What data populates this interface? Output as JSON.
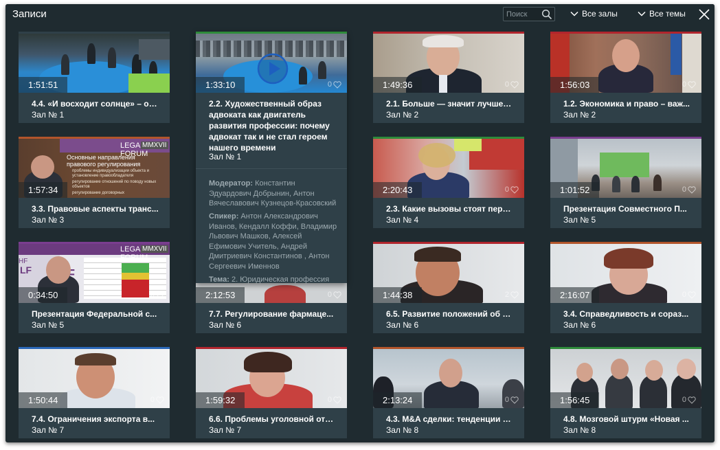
{
  "header": {
    "title": "Записи",
    "search_placeholder": "Поиск",
    "filter_halls": "Все залы",
    "filter_topics": "Все темы"
  },
  "colors": {
    "background": "#1f2b30",
    "card": "#2f4048",
    "accent_green": "#2e8b3a",
    "accent_red": "#b1252d",
    "accent_purple": "#7a3d8f",
    "accent_blue": "#2a68b8",
    "accent_brown": "#b2552b"
  },
  "cards": [
    {
      "title": "4.4. «И восходит солнце» – оц...",
      "hall": "Зал № 1",
      "duration": "1:51:51",
      "likes": "",
      "accent": "none"
    },
    {
      "title": "2.2. Художественный образ адвоката как двигатель развития профессии: почему адвокат так и не стал героем нашего времени",
      "hall": "Зал № 1",
      "duration": "1:33:10",
      "likes": "0",
      "accent": "green",
      "moderator_label": "Модератор:",
      "moderator": "Константин Эдуардович Добрынин, Антон Вячеславович Кузнецов-Красовский",
      "speaker_label": "Спикер:",
      "speakers": "Антон Александрович Иванов, Кендалл Коффи, Владимир Львович Машков, Алексей Ефимович Учитель, Андрей Дмитриевич Константинов , Антон Сергеевич Именнов",
      "topic_label": "Тема:",
      "topic": "2. Юридическая профессия"
    },
    {
      "title": "2.1. Больше — значит лучше?...",
      "hall": "Зал № 2",
      "duration": "1:49:36",
      "likes": "0",
      "accent": "red"
    },
    {
      "title": "1.2. Экономика и право – важ...",
      "hall": "Зал № 2",
      "duration": "1:56:03",
      "likes": "0",
      "accent": "red"
    },
    {
      "title": "3.3. Правовые аспекты транс...",
      "hall": "Зал № 3",
      "duration": "1:57:34",
      "likes": "",
      "accent": "brown"
    },
    {
      "title": "2.3. Какие вызовы стоят пере...",
      "hall": "Зал № 4",
      "duration": "2:20:43",
      "likes": "0",
      "accent": "green"
    },
    {
      "title": "Презентация Совместного П...",
      "hall": "Зал № 5",
      "duration": "1:01:52",
      "likes": "0",
      "accent": "purple"
    },
    {
      "title": "Презентация Федеральной с...",
      "hall": "Зал № 5",
      "duration": "0:34:50",
      "likes": "0",
      "accent": "purple"
    },
    {
      "title": "7.7. Регулирование фармаце...",
      "hall": "Зал № 6",
      "duration": "2:12:53",
      "likes": "0",
      "accent": "none"
    },
    {
      "title": "6.5. Развитие положений об о...",
      "hall": "Зал № 6",
      "duration": "1:44:38",
      "likes": "2",
      "accent": "red"
    },
    {
      "title": "3.4. Справедливость и сораз...",
      "hall": "Зал № 6",
      "duration": "2:16:07",
      "likes": "0",
      "accent": "brown"
    },
    {
      "title": "7.4. Ограничения экспорта в...",
      "hall": "Зал № 7",
      "duration": "1:50:44",
      "likes": "0",
      "accent": "blue"
    },
    {
      "title": "6.6. Проблемы уголовной отв...",
      "hall": "Зал № 7",
      "duration": "1:59:32",
      "likes": "0",
      "accent": "red"
    },
    {
      "title": "4.3. M&A сделки: тенденции и...",
      "hall": "Зал № 8",
      "duration": "2:13:24",
      "likes": "0",
      "accent": "brown"
    },
    {
      "title": "4.8. Мозговой штурм «Новая ...",
      "hall": "Зал № 8",
      "duration": "1:56:45",
      "likes": "0",
      "accent": "green"
    }
  ],
  "slides": {
    "legal_forum": "LEGAL FORUM",
    "mmxvii": "MMXVII",
    "slide_title": "Основные направления правового регулирования",
    "slide_points": [
      "проблемы индивидуализации объекта и установление правообладателя",
      "регулирование отношений по поводу новых объектов",
      "регулирование договорных"
    ],
    "lf": "LF",
    "hf": "HF"
  }
}
